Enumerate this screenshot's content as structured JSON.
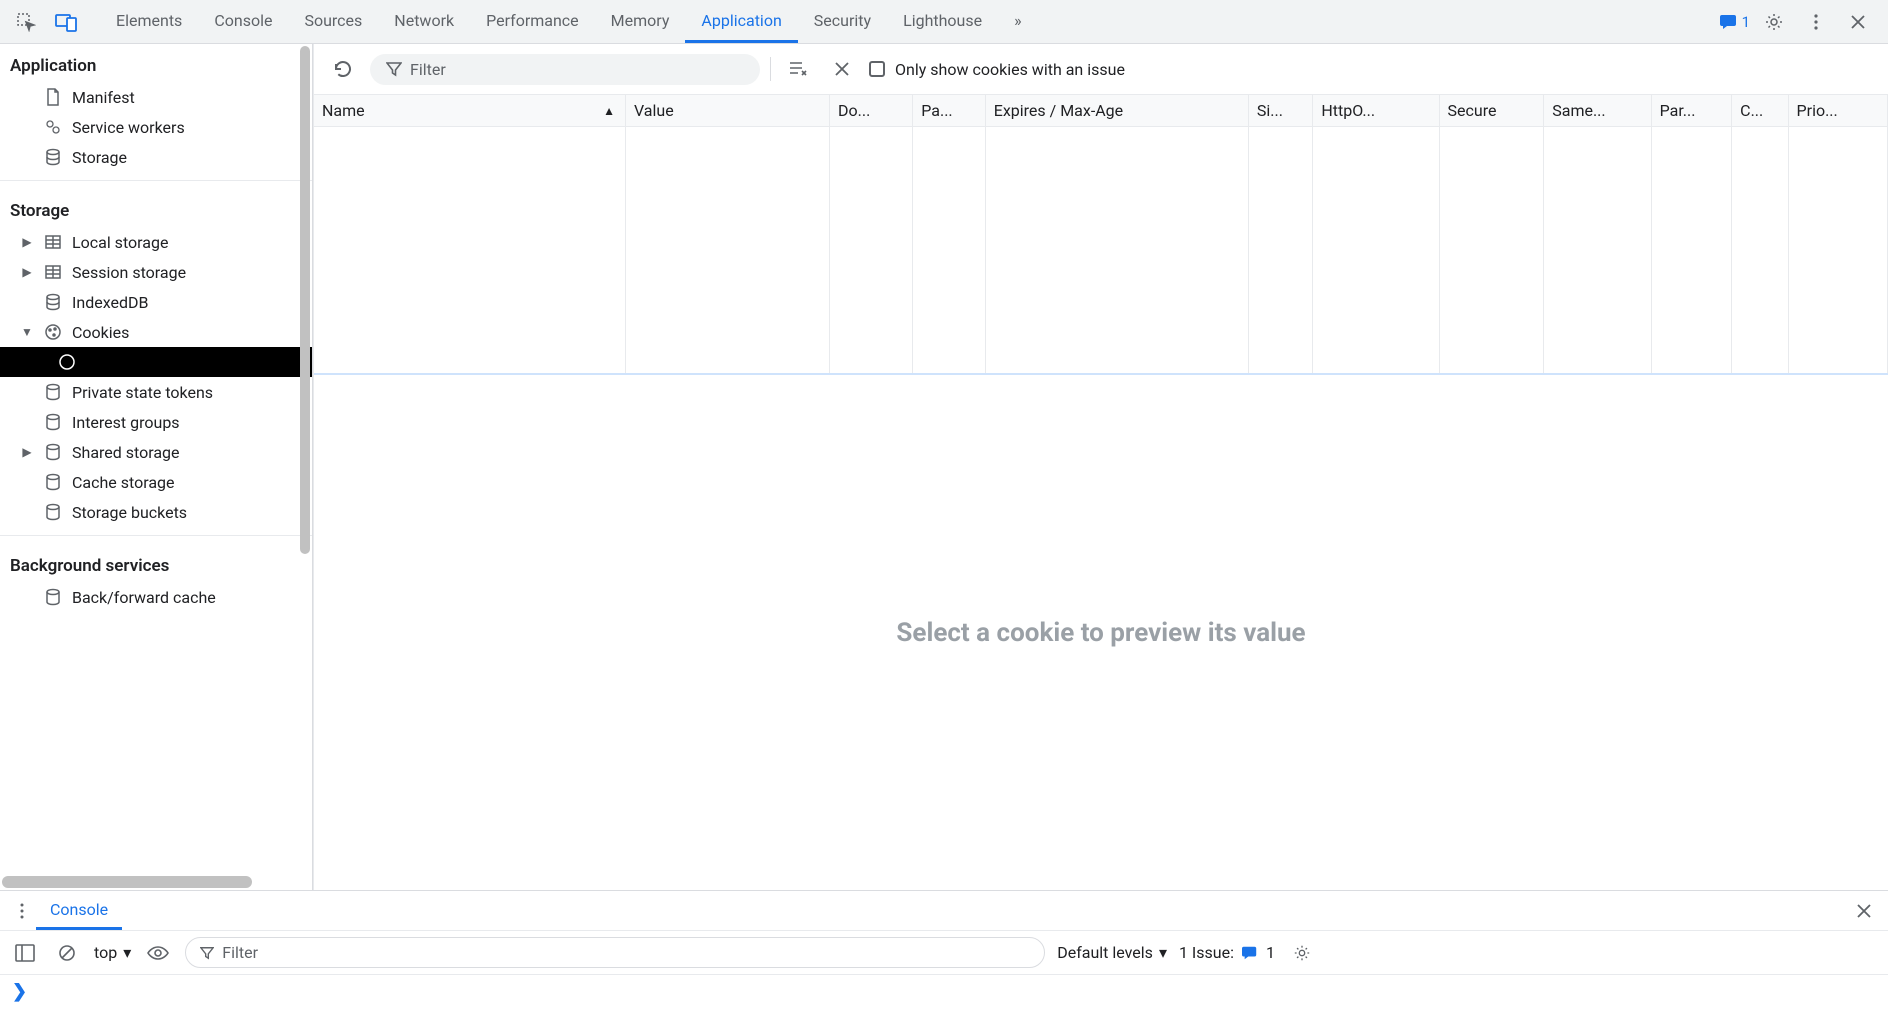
{
  "toolbar": {
    "tabs": [
      "Elements",
      "Console",
      "Sources",
      "Network",
      "Performance",
      "Memory",
      "Application",
      "Security",
      "Lighthouse"
    ],
    "active_tab": "Application",
    "issue_count": "1"
  },
  "sidebar": {
    "sections": {
      "application": {
        "title": "Application",
        "items": [
          "Manifest",
          "Service workers",
          "Storage"
        ]
      },
      "storage": {
        "title": "Storage",
        "items": {
          "local": "Local storage",
          "session": "Session storage",
          "indexed": "IndexedDB",
          "cookies": "Cookies",
          "pst": "Private state tokens",
          "ig": "Interest groups",
          "shared": "Shared storage",
          "cache": "Cache storage",
          "buckets": "Storage buckets"
        }
      },
      "bg": {
        "title": "Background services",
        "items": [
          "Back/forward cache"
        ]
      }
    }
  },
  "filterbar": {
    "filter_placeholder": "Filter",
    "only_issue_label": "Only show cookies with an issue"
  },
  "table": {
    "columns": [
      "Name",
      "Value",
      "Do...",
      "Pa...",
      "Expires / Max-Age",
      "Si...",
      "HttpO...",
      "Secure",
      "Same...",
      "Par...",
      "C...",
      "Prio..."
    ]
  },
  "preview": {
    "empty_msg": "Select a cookie to preview its value"
  },
  "drawer": {
    "tab": "Console",
    "scope": "top",
    "filter_placeholder": "Filter",
    "levels": "Default levels",
    "issues_label": "1 Issue:",
    "issues_count": "1",
    "prompt": "❯"
  }
}
